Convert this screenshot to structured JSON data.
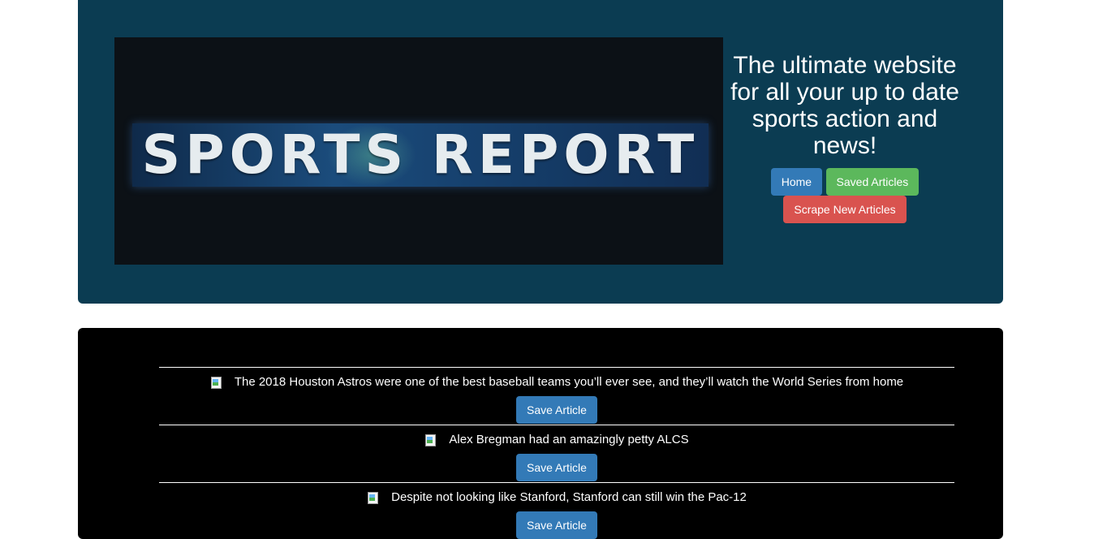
{
  "header": {
    "logo_text": "SPORTS REPORT",
    "tagline": "The ultimate website for all your up to date sports action and news!",
    "nav": {
      "home_label": "Home",
      "saved_label": "Saved Articles",
      "scrape_label": "Scrape New Articles"
    }
  },
  "articles": [
    {
      "headline": "The 2018 Houston Astros were one of the best baseball teams you’ll ever see, and they’ll watch the World Series from home",
      "save_label": "Save Article"
    },
    {
      "headline": "Alex Bregman had an amazingly petty ALCS",
      "save_label": "Save Article"
    },
    {
      "headline": "Despite not looking like Stanford, Stanford can still win the Pac-12",
      "save_label": "Save Article"
    }
  ],
  "colors": {
    "header_bg": "#0b3c52",
    "primary": "#337ab7",
    "success": "#5cb85c",
    "danger": "#d9534f"
  },
  "icons": {
    "article_image": "broken-image-icon"
  }
}
